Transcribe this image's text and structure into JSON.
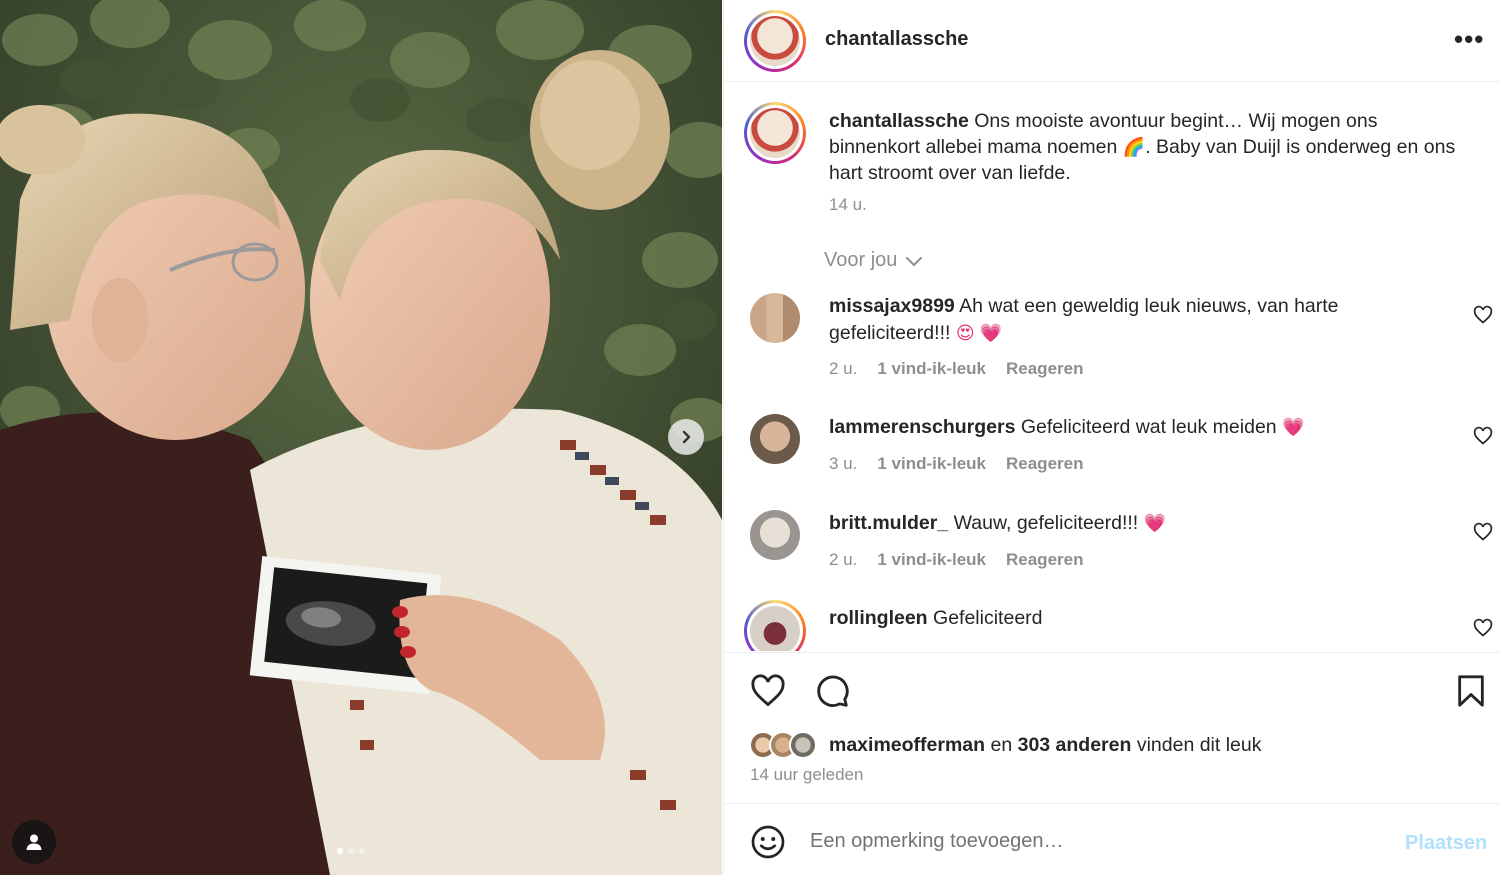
{
  "post": {
    "username": "chantallassche",
    "more_icon": "more-horizontal-icon",
    "more_label": "•••"
  },
  "caption": {
    "username": "chantallassche",
    "text_before_emoji": "Ons mooiste avontuur begint… Wij mogen ons binnenkort allebei mama noemen ",
    "emoji": "🌈",
    "text_after_emoji": ". Baby van Duijl is onderweg en ons hart stroomt over van liefde.",
    "time": "14 u."
  },
  "for_you": "Voor jou",
  "comments": [
    {
      "username": "missajax9899",
      "text": "Ah wat een geweldig leuk nieuws, van harte gefeliciteerd!!! ",
      "emoji": "😍 💗",
      "time": "2 u.",
      "likes": "1 vind-ik-leuk",
      "reply": "Reageren"
    },
    {
      "username": "lammerenschurgers",
      "text": "Gefeliciteerd wat leuk meiden ",
      "emoji": "💗",
      "time": "3 u.",
      "likes": "1 vind-ik-leuk",
      "reply": "Reageren"
    },
    {
      "username": "britt.mulder_",
      "text": "Wauw, gefeliciteerd!!! ",
      "emoji": "💗",
      "time": "2 u.",
      "likes": "1 vind-ik-leuk",
      "reply": "Reageren"
    },
    {
      "username": "rollingleen",
      "text": "Gefeliciteerd",
      "emoji": "",
      "time": "",
      "likes": "",
      "reply": ""
    }
  ],
  "likes": {
    "first_user": "maximeofferman",
    "connector": " en ",
    "others": "303 anderen",
    "suffix": " vinden dit leuk"
  },
  "post_time": "14 uur geleden",
  "composer": {
    "placeholder": "Een opmerking toevoegen…",
    "post_label": "Plaatsen"
  },
  "colors": {
    "post_button_disabled": "#b2dffc",
    "muted_text": "#8e8e8e",
    "heart_emoji": "#e8336b"
  },
  "carousel": {
    "slide_count": 3,
    "active_slide": 0
  }
}
